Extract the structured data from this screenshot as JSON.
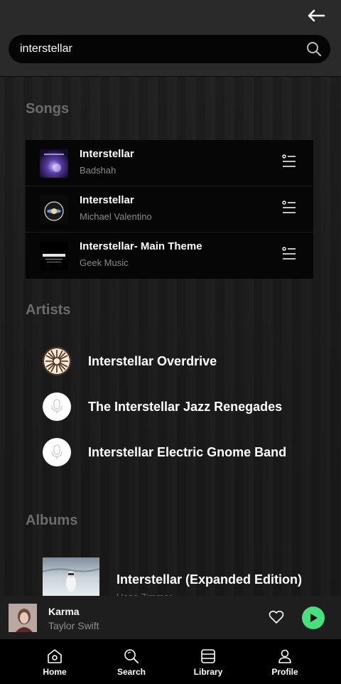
{
  "search": {
    "query": "interstellar"
  },
  "sections": {
    "songs": "Songs",
    "artists": "Artists",
    "albums": "Albums"
  },
  "songs": [
    {
      "title": "Interstellar",
      "artist": "Badshah"
    },
    {
      "title": "Interstellar",
      "artist": "Michael Valentino"
    },
    {
      "title": "Interstellar- Main Theme",
      "artist": "Geek Music"
    }
  ],
  "artists": [
    {
      "name": "Interstellar Overdrive"
    },
    {
      "name": "The Interstellar Jazz Renegades"
    },
    {
      "name": "Interstellar Electric Gnome Band"
    }
  ],
  "albums": [
    {
      "title": "Interstellar (Expanded Edition)",
      "artist": "Hans Zimmer"
    }
  ],
  "now_playing": {
    "title": "Karma",
    "artist": "Taylor Swift"
  },
  "tabs": [
    {
      "label": "Home",
      "icon": "home-icon"
    },
    {
      "label": "Search",
      "icon": "search-icon"
    },
    {
      "label": "Library",
      "icon": "library-icon"
    },
    {
      "label": "Profile",
      "icon": "profile-icon"
    }
  ],
  "colors": {
    "accent": "#4ade80",
    "background": "#181818",
    "header": "#2a2a2a"
  }
}
